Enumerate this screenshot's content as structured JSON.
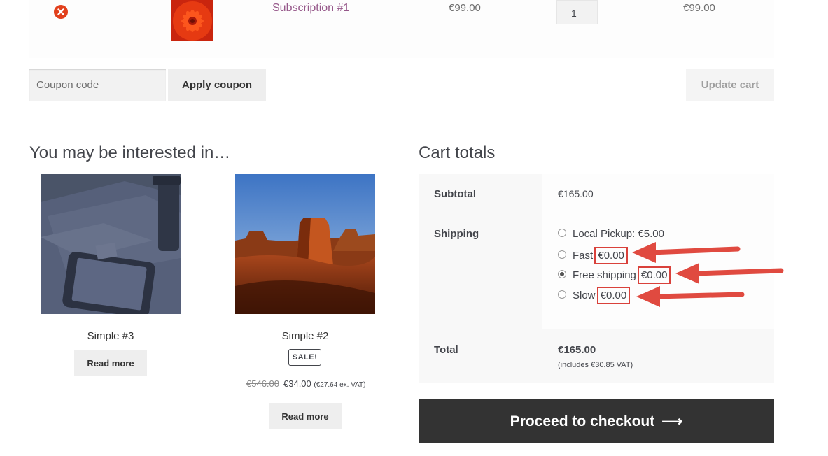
{
  "cart_item": {
    "remove_icon": "remove-icon",
    "product_name": "Subscription #1",
    "price": "€99.00",
    "quantity": "1",
    "subtotal": "€99.00"
  },
  "coupon": {
    "placeholder": "Coupon code",
    "apply_label": "Apply coupon",
    "update_label": "Update cart"
  },
  "interest": {
    "title": "You may be interested in…",
    "products": [
      {
        "name": "Simple #3",
        "button": "Read more"
      },
      {
        "name": "Simple #2",
        "badge": "SALE!",
        "old_price": "€546.00",
        "price": "€34.00",
        "vat": "(€27.64 ex. VAT)",
        "button": "Read more"
      }
    ]
  },
  "totals": {
    "title": "Cart totals",
    "subtotal_label": "Subtotal",
    "subtotal_value": "€165.00",
    "shipping_label": "Shipping",
    "shipping_options": [
      {
        "name": "Local Pickup: €5.00",
        "price": "",
        "checked": false
      },
      {
        "name": "Fast",
        "price": "€0.00",
        "checked": false
      },
      {
        "name": "Free shipping",
        "price": "€0.00",
        "checked": true
      },
      {
        "name": "Slow",
        "price": "€0.00",
        "checked": false
      }
    ],
    "total_label": "Total",
    "total_value": "€165.00",
    "total_vat": "(includes €30.85 VAT)"
  },
  "checkout": {
    "label": "Proceed to checkout",
    "arrow": "⟶"
  },
  "colors": {
    "accent": "#96588a",
    "remove": "#e2401c",
    "annotation": "#d9413b",
    "checkout_bg": "#333333"
  }
}
